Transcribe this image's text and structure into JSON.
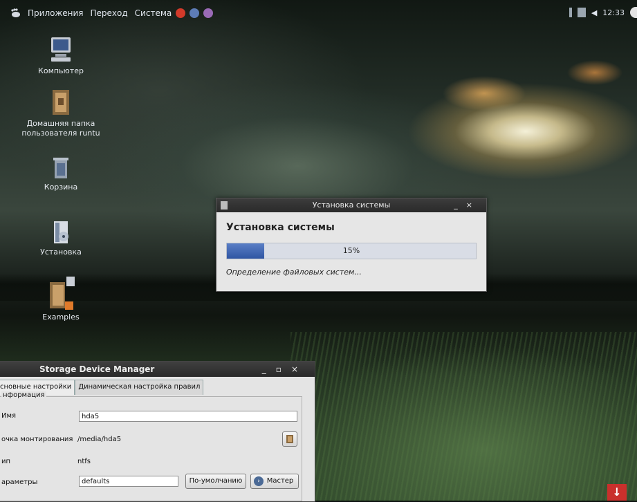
{
  "top_panel": {
    "menu": [
      "Приложения",
      "Переход",
      "Система"
    ],
    "clock": "12:33"
  },
  "desktop_icons": [
    {
      "label": "Компьютер",
      "icon": "computer-icon"
    },
    {
      "label": "Домашняя папка пользователя runtu",
      "icon": "home-folder-icon"
    },
    {
      "label": "Корзина",
      "icon": "trash-icon"
    },
    {
      "label": "Установка",
      "icon": "installer-icon"
    },
    {
      "label": "Examples",
      "icon": "examples-folder-icon"
    }
  ],
  "install_dialog": {
    "title": "Установка системы",
    "heading": "Установка системы",
    "progress": 15,
    "progress_label": "15%",
    "status": "Определение файловых систем..."
  },
  "storage_manager": {
    "title": "Storage Device Manager",
    "tabs": [
      "сновные настройки",
      "Динамическая настройка правил"
    ],
    "group_title": "нформация",
    "rows": {
      "name_label": "Имя",
      "name_value": "hda5",
      "mount_label": "очка монтирования",
      "mount_value": "/media/hda5",
      "type_label": "ип",
      "type_value": "ntfs",
      "params_label": "араметры",
      "params_value": "defaults"
    },
    "default_button": "По-умолчанию",
    "wizard_button": "Мастер"
  },
  "colors": {
    "progress_fill": "#2f55a3",
    "titlebar": "#2a2a2a"
  }
}
